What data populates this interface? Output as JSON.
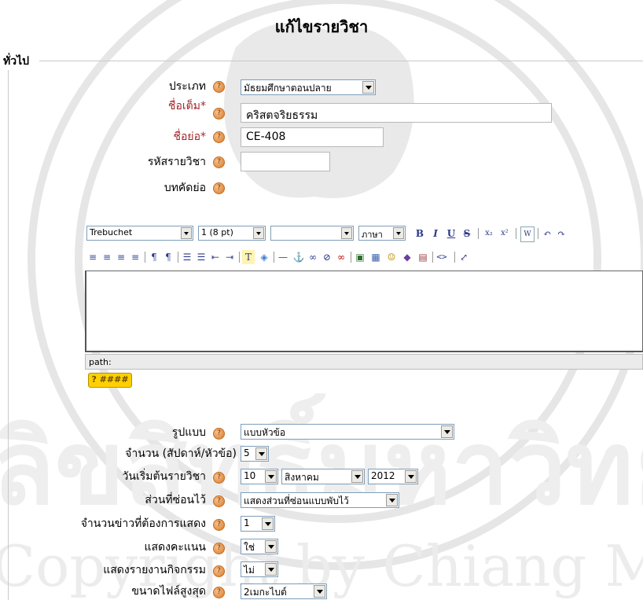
{
  "page_title": "แก้ไขรายวิชา",
  "section_legend": "ทั่วไป",
  "help_glyph": "?",
  "fields": {
    "category": {
      "label": "ประเภท",
      "value": "มัธยมศึกษาตอนปลาย"
    },
    "fullname": {
      "label": "ชื่อเต็ม*",
      "value": "คริสตจริยธรรม"
    },
    "shortname": {
      "label": "ชื่อย่อ*",
      "value": "CE-408"
    },
    "idnumber": {
      "label": "รหัสรายวิชา",
      "value": ""
    },
    "summary": {
      "label": "บทคัดย่อ"
    }
  },
  "editor": {
    "font_family": "Trebuchet",
    "font_size": "1 (8 pt)",
    "style": "",
    "language": "ภาษา",
    "path_label": "path:",
    "keyboard_button": "? ####",
    "row1_buttons": [
      "B",
      "I",
      "U",
      "S",
      "x₂",
      "x²",
      "W",
      "↶",
      "↷"
    ],
    "row2_buttons": [
      "≡",
      "≡",
      "≡",
      "≡",
      "¶",
      "¶",
      "☰",
      "☰",
      "⇤",
      "⇥",
      "T",
      "◈",
      "—",
      "⚓",
      "∞",
      "⊘",
      "∞",
      "▣",
      "▦",
      "☺",
      "◆",
      "▤",
      "<>",
      "⤢"
    ]
  },
  "settings": {
    "format": {
      "label": "รูปแบบ",
      "value": "แบบหัวข้อ"
    },
    "numsections": {
      "label": "จำนวน (สัปดาห์/หัวข้อ)",
      "value": "5"
    },
    "startdate": {
      "label": "วันเริ่มต้นรายวิชา",
      "day": "10",
      "month": "สิงหาคม",
      "year": "2012"
    },
    "hiddensections": {
      "label": "ส่วนที่ซ่อนไว้",
      "value": "แสดงส่วนที่ซ่อนแบบพับไว้"
    },
    "newsitems": {
      "label": "จำนวนข่าวที่ต้องการแสดง",
      "value": "1"
    },
    "showgrades": {
      "label": "แสดงคะแนน",
      "value": "ใช่"
    },
    "showreports": {
      "label": "แสดงรายงานกิจกรรม",
      "value": "ไม่"
    },
    "maxbytes": {
      "label": "ขนาดไฟล์สูงสุด",
      "value": "2เมกะไบต์"
    }
  }
}
